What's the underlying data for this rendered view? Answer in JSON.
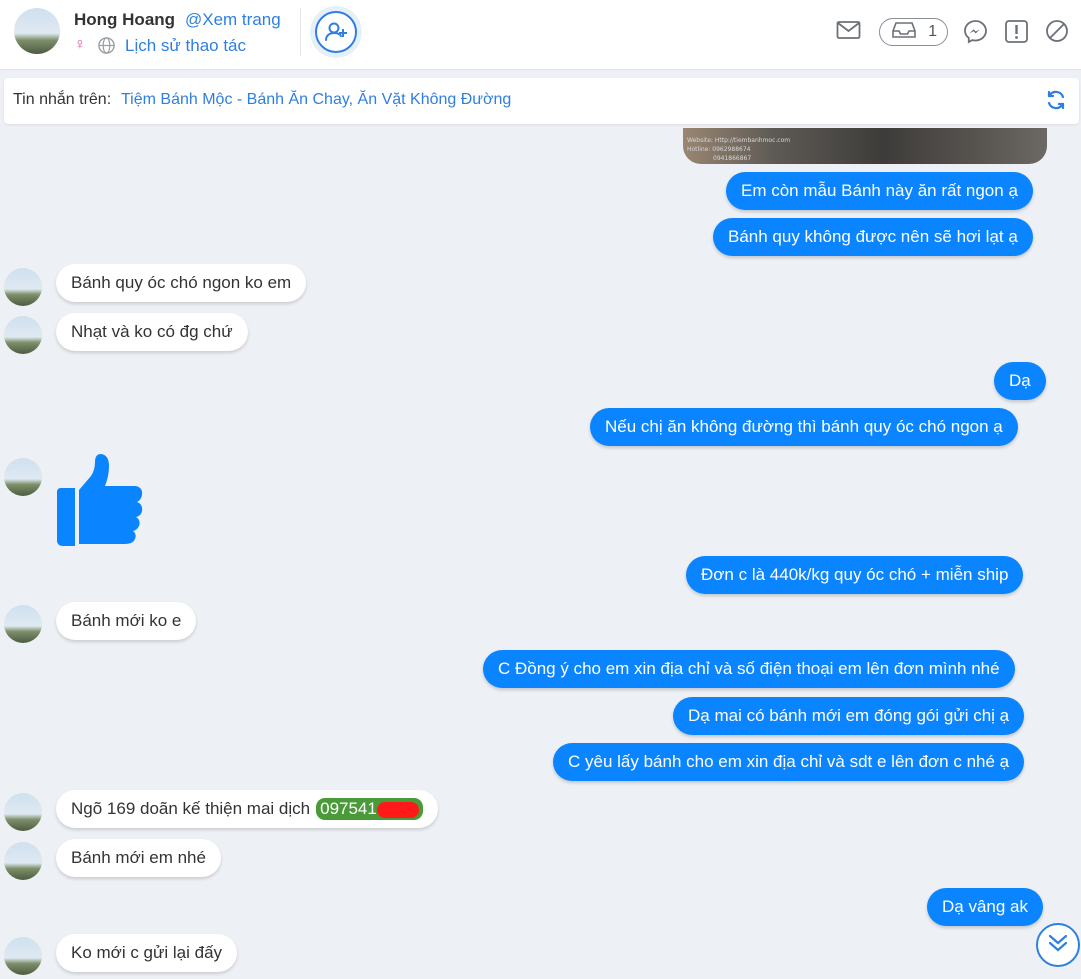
{
  "header": {
    "user_name": "Hong Hoang",
    "user_link": "@Xem trang",
    "history_link": "Lịch sử thao tác",
    "inbox_count": "1"
  },
  "source": {
    "label": "Tin nhắn trên:",
    "page_name": "Tiệm Bánh Mộc - Bánh Ăn Chay, Ăn Vặt Không Đường"
  },
  "image_watermark": {
    "website": "Website: Http://tiembanhmoc.com",
    "hotline": "Hotline: 0962988674",
    "phone2": "0941866867"
  },
  "messages": [
    {
      "dir": "out",
      "text": "Em còn mẫu Bánh này ăn rất ngon ạ"
    },
    {
      "dir": "out",
      "text": "Bánh quy không được nên sẽ hơi lạt ạ"
    },
    {
      "dir": "in",
      "text": "Bánh quy óc chó ngon ko em"
    },
    {
      "dir": "in",
      "text": "Nhạt và ko có đg chứ"
    },
    {
      "dir": "out",
      "text": "Dạ"
    },
    {
      "dir": "out",
      "text": "Nếu chị ăn không đường thì bánh quy óc chó ngon ạ"
    },
    {
      "dir": "in",
      "type": "like"
    },
    {
      "dir": "out",
      "text": "Đơn c là 440k/kg quy óc chó + miễn ship"
    },
    {
      "dir": "in",
      "text": "Bánh mới ko e"
    },
    {
      "dir": "out",
      "text": "C Đồng ý cho em xin địa chỉ và số điện thoại em lên đơn mình nhé"
    },
    {
      "dir": "out",
      "text": "Dạ mai có bánh mới em đóng gói gửi chị ạ"
    },
    {
      "dir": "out",
      "text": "C yêu lấy bánh cho em xin địa chỉ và sdt e lên đơn c nhé ạ"
    },
    {
      "dir": "in",
      "text": "Ngõ 169 doãn kế thiện mai dịch",
      "phone": "097541"
    },
    {
      "dir": "in",
      "text": "Bánh mới em nhé"
    },
    {
      "dir": "out",
      "text": "Dạ vâng ak"
    },
    {
      "dir": "in",
      "text": "Ko mới c gửi lại đấy"
    }
  ],
  "colors": {
    "outgoing": "#0a84ff",
    "incoming": "#ffffff",
    "link": "#2f7fe0",
    "phone_highlight": "#4a9a3a",
    "redaction": "#ff1a1a"
  }
}
